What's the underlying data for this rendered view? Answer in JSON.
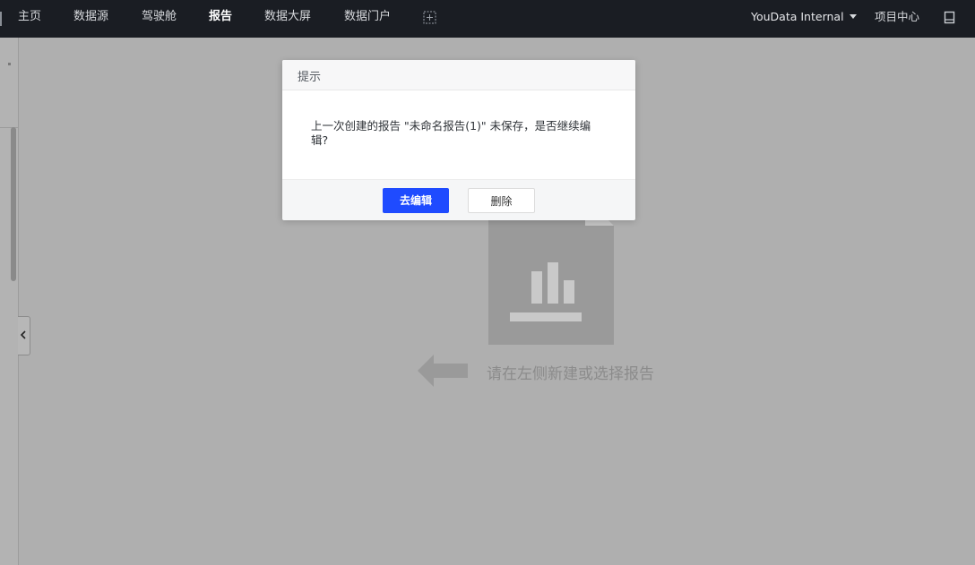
{
  "nav": {
    "items": [
      {
        "label": "主页"
      },
      {
        "label": "数据源"
      },
      {
        "label": "驾驶舱"
      },
      {
        "label": "报告"
      },
      {
        "label": "数据大屏"
      },
      {
        "label": "数据门户"
      }
    ],
    "active": "报告",
    "org_name": "YouData Internal",
    "project_center": "项目中心"
  },
  "empty_state": {
    "message": "请在左侧新建或选择报告"
  },
  "dialog": {
    "title": "提示",
    "message_line1": "上一次创建的报告 \"未命名报告(1)\" 未保存，是否继续编",
    "message_line2": "辑?",
    "primary_button": "去编辑",
    "secondary_button": "删除"
  },
  "colors": {
    "nav_bg": "#1a1d23",
    "overlay": "#afafaf",
    "primary": "#1f4bff"
  }
}
